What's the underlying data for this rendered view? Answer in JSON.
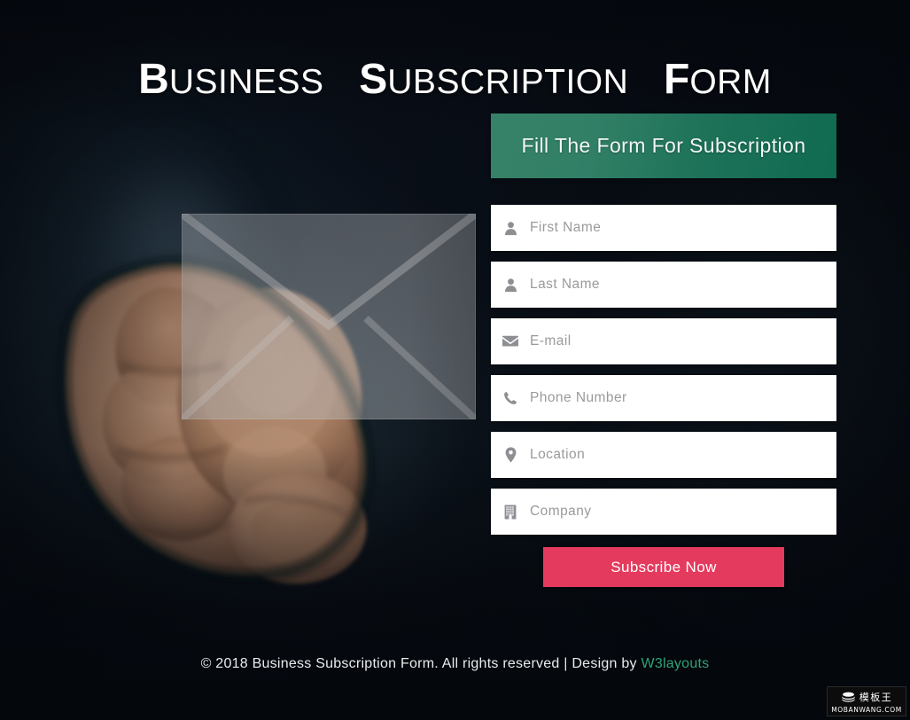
{
  "page": {
    "title_words": [
      {
        "cap": "B",
        "rest": "USINESS"
      },
      {
        "cap": "S",
        "rest": "UBSCRIPTION"
      },
      {
        "cap": "F",
        "rest": "ORM"
      }
    ],
    "title_plain": "BUSINESS SUBSCRIPTION FORM"
  },
  "form": {
    "header": "Fill The Form For Subscription",
    "fields": [
      {
        "icon": "user-icon",
        "placeholder": "First Name",
        "value": ""
      },
      {
        "icon": "user-icon",
        "placeholder": "Last Name",
        "value": ""
      },
      {
        "icon": "envelope-icon",
        "placeholder": "E-mail",
        "value": ""
      },
      {
        "icon": "phone-icon",
        "placeholder": "Phone Number",
        "value": ""
      },
      {
        "icon": "map-pin-icon",
        "placeholder": "Location",
        "value": ""
      },
      {
        "icon": "building-icon",
        "placeholder": "Company",
        "value": ""
      }
    ],
    "submit_label": "Subscribe Now"
  },
  "footer": {
    "text": "© 2018 Business Subscription Form. All rights reserved | Design by ",
    "brand": "W3layouts"
  },
  "watermark": {
    "icon": "stacked-books-icon",
    "cn_label": "模板王",
    "url": "MOBANWANG.COM"
  },
  "colors": {
    "header_green": "#1e785c",
    "button_crimson": "#e43a5d",
    "brand_green": "#2fa478",
    "background_dark": "#05070c",
    "field_white": "#ffffff",
    "placeholder_gray": "#9a9a9c",
    "icon_gray": "#8d8f93"
  }
}
